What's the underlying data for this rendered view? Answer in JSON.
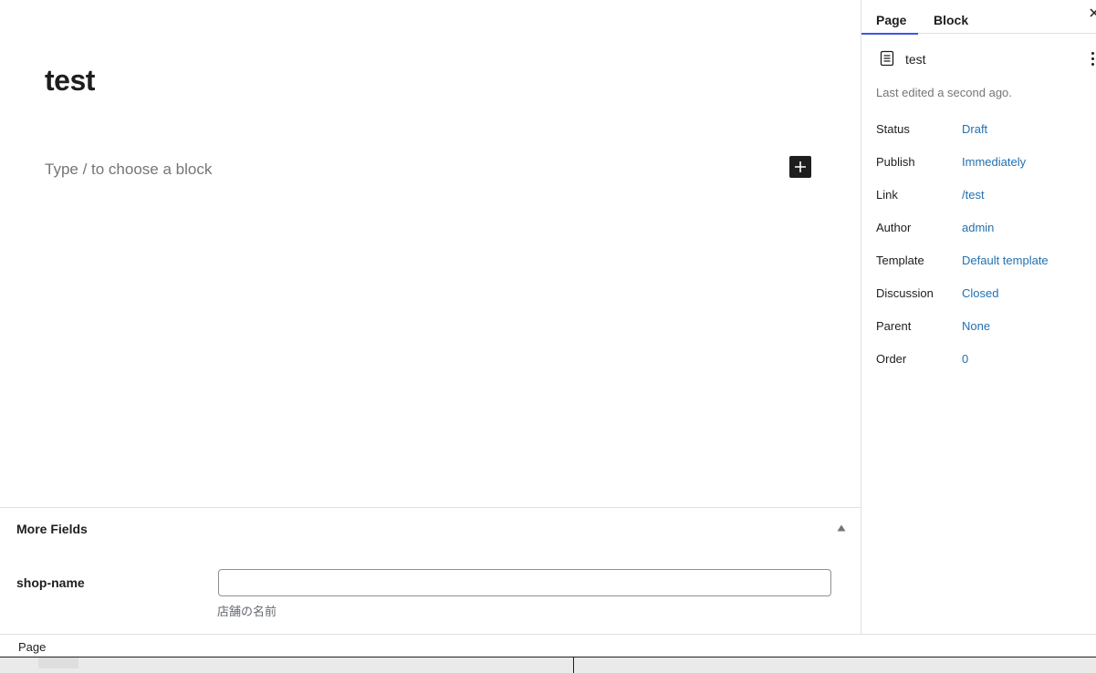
{
  "editor": {
    "title": "test",
    "placeholder": "Type / to choose a block",
    "inserter_icon": "plus-icon"
  },
  "metabox": {
    "title": "More Fields",
    "toggle_icon": "triangle-up-icon",
    "fields": [
      {
        "label": "shop-name",
        "value": "",
        "description": "店舗の名前"
      }
    ]
  },
  "footer": {
    "breadcrumb": "Page"
  },
  "sidebar": {
    "tabs": [
      {
        "label": "Page",
        "active": true
      },
      {
        "label": "Block",
        "active": false
      }
    ],
    "close_icon": "close-icon",
    "document": {
      "icon": "page-icon",
      "title": "test",
      "more_icon": "more-vertical-icon"
    },
    "last_edited": "Last edited a second ago.",
    "rows": [
      {
        "label": "Status",
        "value": "Draft"
      },
      {
        "label": "Publish",
        "value": "Immediately"
      },
      {
        "label": "Link",
        "value": "/test"
      },
      {
        "label": "Author",
        "value": "admin"
      },
      {
        "label": "Template",
        "value": "Default template"
      },
      {
        "label": "Discussion",
        "value": "Closed"
      },
      {
        "label": "Parent",
        "value": "None"
      },
      {
        "label": "Order",
        "value": "0"
      }
    ],
    "link_color": "#2271b1",
    "tab_accent_color": "#3858e9"
  }
}
